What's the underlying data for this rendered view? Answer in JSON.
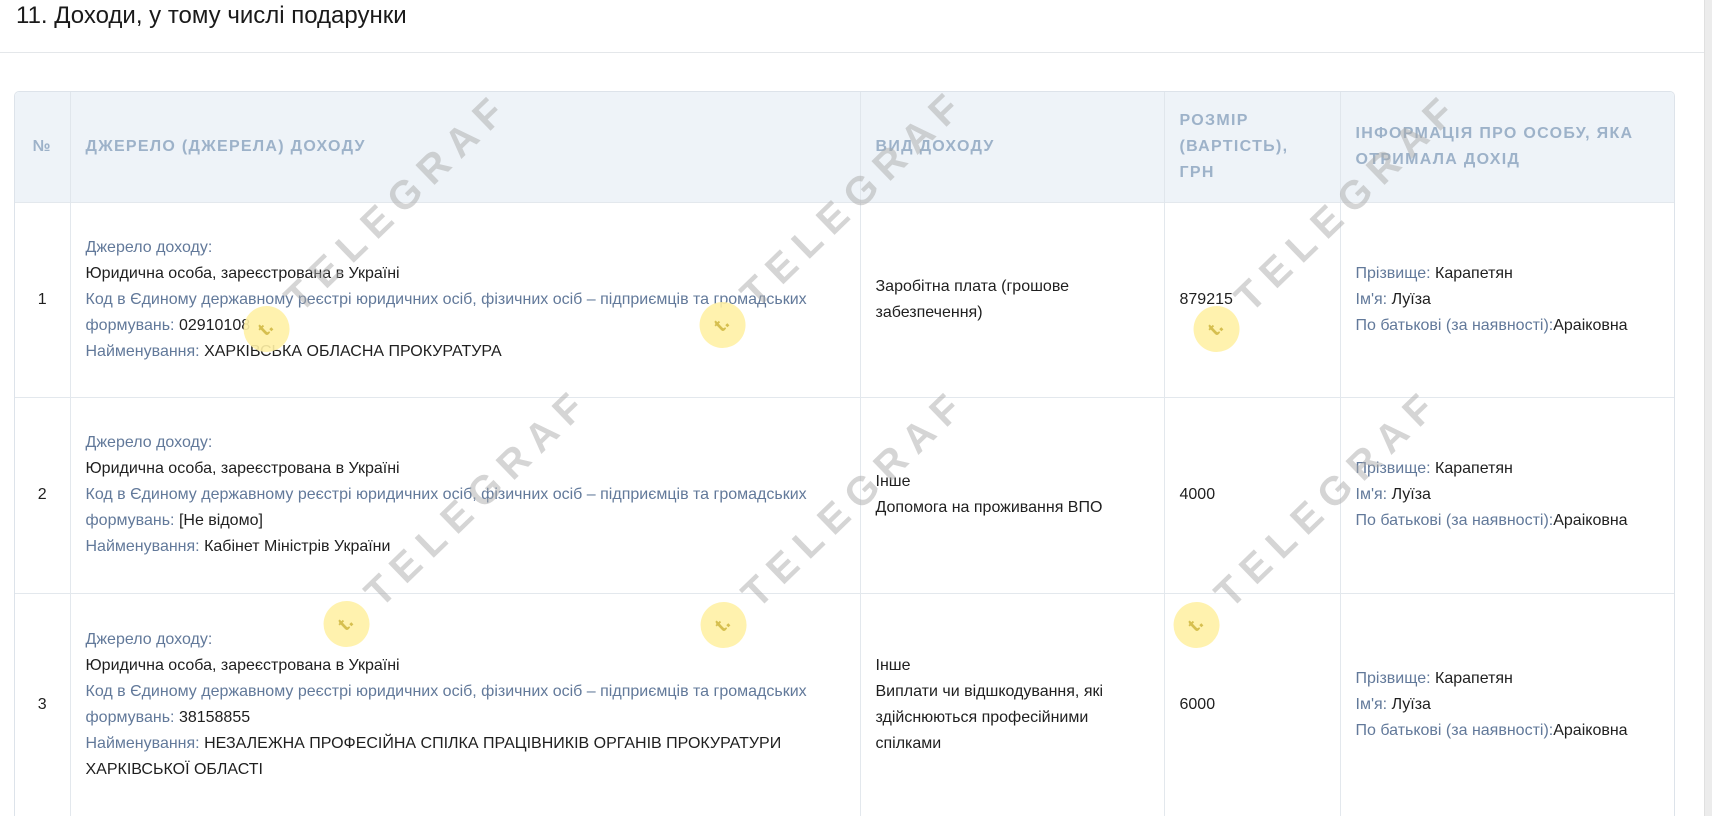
{
  "section": {
    "title": "11. Доходи, у тому числі подарунки"
  },
  "watermark": {
    "text": "TELEGRAF",
    "logo_icon": "telegraf-logo-icon",
    "logo_color": "#fff1a6"
  },
  "colors": {
    "header_bg": "#eef3f8",
    "header_text": "#9db2c9",
    "label_text": "#62799a",
    "value_text": "#1f1f1f"
  },
  "table": {
    "headers": {
      "num": "№",
      "source": "ДЖЕРЕЛО (ДЖЕРЕЛА) ДОХОДУ",
      "type": "ВИД ДОХОДУ",
      "amount": "РОЗМІР (ВАРТІСТЬ), ГРН",
      "person": "ІНФОРМАЦІЯ ПРО ОСОБУ, ЯКА ОТРИМАЛА ДОХІД"
    },
    "rows": [
      {
        "num": "1",
        "source_label": "Джерело доходу:",
        "source_value": "Юридична особа, зареєстрована в Україні",
        "code_label": "Код в Єдиному державному реєстрі юридичних осіб, фізичних осіб – підприємців та громадських формувань:",
        "code_value": "02910108",
        "name_label": "Найменування:",
        "name_value": "ХАРКІВСЬКА ОБЛАСНА ПРОКУРАТУРА",
        "type_line1": "Заробітна плата (грошове забезпечення)",
        "type_line2": "",
        "amount": "879215",
        "surname_label": "Прізвище:",
        "surname": "Карапетян",
        "firstname_label": "Ім'я:",
        "firstname": "Луїза",
        "patronymic_label": "По батькові (за наявності):",
        "patronymic": "Араіковна"
      },
      {
        "num": "2",
        "source_label": "Джерело доходу:",
        "source_value": "Юридична особа, зареєстрована в Україні",
        "code_label": "Код в Єдиному державному реєстрі юридичних осіб, фізичних осіб – підприємців та громадських формувань:",
        "code_value": "[Не відомо]",
        "name_label": "Найменування:",
        "name_value": "Кабінет Міністрів України",
        "type_line1": "Інше",
        "type_line2": "Допомога на проживання ВПО",
        "amount": "4000",
        "surname_label": "Прізвище:",
        "surname": "Карапетян",
        "firstname_label": "Ім'я:",
        "firstname": "Луїза",
        "patronymic_label": "По батькові (за наявності):",
        "patronymic": "Араіковна"
      },
      {
        "num": "3",
        "source_label": "Джерело доходу:",
        "source_value": "Юридична особа, зареєстрована в Україні",
        "code_label": "Код в Єдиному державному реєстрі юридичних осіб, фізичних осіб – підприємців та громадських формувань:",
        "code_value": "38158855",
        "name_label": "Найменування:",
        "name_value": "НЕЗАЛЕЖНА ПРОФЕСІЙНА СПІЛКА ПРАЦІВНИКІВ ОРГАНІВ ПРОКУРАТУРИ ХАРКІВСЬКОЇ ОБЛАСТІ",
        "type_line1": "Інше",
        "type_line2": "Виплати чи відшкодування, які здійснюються професійними спілками",
        "amount": "6000",
        "surname_label": "Прізвище:",
        "surname": "Карапетян",
        "firstname_label": "Ім'я:",
        "firstname": "Луїза",
        "patronymic_label": "По батькові (за наявності):",
        "patronymic": "Араіковна"
      }
    ]
  }
}
